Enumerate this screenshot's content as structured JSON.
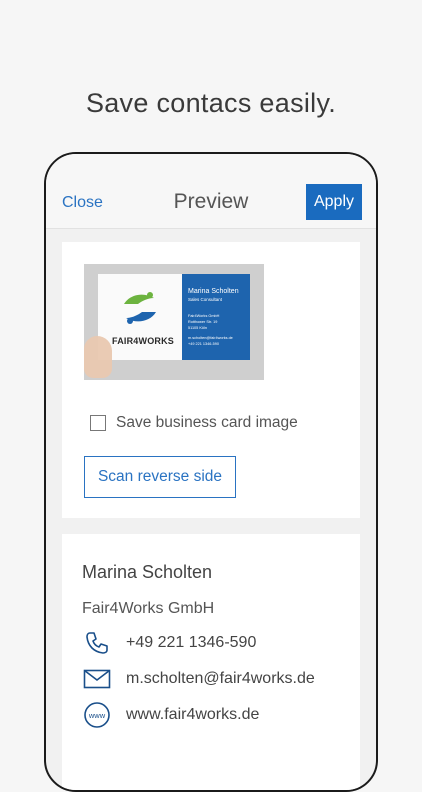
{
  "headline": "Save contacs easily.",
  "nav": {
    "close_label": "Close",
    "title": "Preview",
    "apply_label": "Apply"
  },
  "business_card": {
    "name": "Marina Scholten",
    "role": "Sales Consultant",
    "company": "FAIR4WORKS",
    "lines": [
      "Fair4Works GmbH",
      "Rotthower Str. 19",
      "51105 Köln",
      "m.scholten@fair4works.de",
      "+49 221 1346-590"
    ]
  },
  "options": {
    "save_image_label": "Save business card image",
    "save_image_checked": false,
    "scan_reverse_label": "Scan reverse side"
  },
  "contact": {
    "name": "Marina Scholten",
    "company": "Fair4Works GmbH",
    "phone": "+49 221 1346-590",
    "email": "m.scholten@fair4works.de",
    "website": "www.fair4works.de"
  },
  "icons": {
    "phone": "phone-icon",
    "email": "envelope-icon",
    "website": "www-globe-icon"
  },
  "colors": {
    "accent": "#1a6bbf",
    "card_blue": "#1e64ae",
    "logo_green": "#6cb33f"
  }
}
